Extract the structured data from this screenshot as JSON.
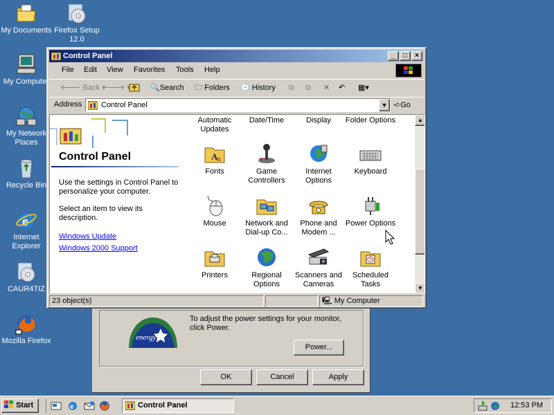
{
  "desktop": {
    "icons": [
      {
        "label": "My Documents"
      },
      {
        "label": "Firefox Setup 12.0"
      },
      {
        "label": "My Computer"
      },
      {
        "label": "My Network Places"
      },
      {
        "label": "Recycle Bin"
      },
      {
        "label": "Internet Explorer"
      },
      {
        "label": "CAUR4TIZ"
      },
      {
        "label": "Mozilla Firefox"
      }
    ]
  },
  "background_dialog": {
    "text": "To adjust the power settings for your monitor, click Power.",
    "power_button": "Power...",
    "ok_button": "OK",
    "cancel_button": "Cancel",
    "apply_button": "Apply",
    "logo_text": "energy"
  },
  "window": {
    "title": "Control Panel",
    "menu": [
      "File",
      "Edit",
      "View",
      "Favorites",
      "Tools",
      "Help"
    ],
    "toolbar": {
      "back": "Back",
      "search": "Search",
      "folders": "Folders",
      "history": "History"
    },
    "address": {
      "label": "Address",
      "value": "Control Panel",
      "go": "Go"
    },
    "left_pane": {
      "title": "Control Panel",
      "description": "Use the settings in Control Panel to personalize your computer.",
      "hint": "Select an item to view its description.",
      "links": [
        "Windows Update",
        "Windows 2000 Support"
      ]
    },
    "partial_row": [
      "Automatic Updates",
      "Date/Time",
      "Display",
      "Folder Options"
    ],
    "items": [
      {
        "label": "Fonts",
        "icon": "fonts-folder-icon"
      },
      {
        "label": "Game Controllers",
        "icon": "joystick-icon"
      },
      {
        "label": "Internet Options",
        "icon": "globe-icon"
      },
      {
        "label": "Keyboard",
        "icon": "keyboard-icon"
      },
      {
        "label": "Mouse",
        "icon": "mouse-icon"
      },
      {
        "label": "Network and Dial-up Co...",
        "icon": "network-folder-icon"
      },
      {
        "label": "Phone and Modem ...",
        "icon": "phone-icon"
      },
      {
        "label": "Power Options",
        "icon": "power-plug-icon"
      },
      {
        "label": "Printers",
        "icon": "printers-folder-icon"
      },
      {
        "label": "Regional Options",
        "icon": "globe-regional-icon"
      },
      {
        "label": "Scanners and Cameras",
        "icon": "scanner-icon"
      },
      {
        "label": "Scheduled Tasks",
        "icon": "scheduled-tasks-folder-icon"
      }
    ],
    "status": {
      "count": "23 object(s)",
      "zone": "My Computer"
    }
  },
  "taskbar": {
    "start": "Start",
    "task": "Control Panel",
    "clock": "12:53 PM"
  },
  "colors": {
    "desktop": "#3a6ea5",
    "titlebar_start": "#0a246a",
    "titlebar_end": "#a6caf0",
    "face": "#d4d0c8",
    "link": "#0000ff"
  }
}
